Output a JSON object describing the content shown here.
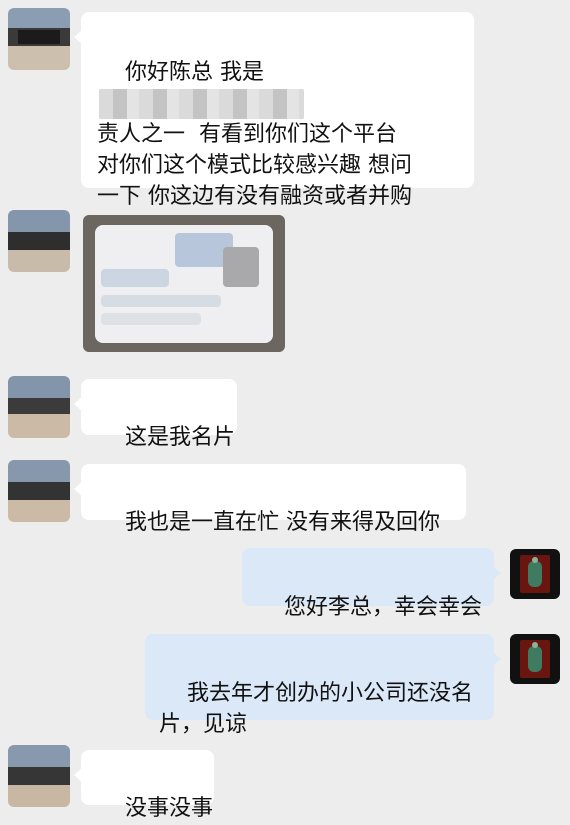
{
  "messages": [
    {
      "side": "in",
      "text_before": "你好陈总 我是",
      "text_after": "\n责人之一  有看到你们这个平台\n对你们这个模式比较感兴趣 想问\n一下 你这边有没有融资或者并购\n的想法 可以聊聊"
    },
    {
      "side": "in",
      "type": "image",
      "content": "blurred business card photo"
    },
    {
      "side": "in",
      "text": "这是我名片"
    },
    {
      "side": "in",
      "text": "我也是一直在忙 没有来得及回你"
    },
    {
      "side": "out",
      "text": "您好李总，幸会幸会"
    },
    {
      "side": "out",
      "text": "我去年才创办的小公司还没名\n片，见谅"
    },
    {
      "side": "in",
      "text": "没事没事"
    }
  ],
  "colors": {
    "background": "#ededed",
    "incoming_bubble": "#ffffff",
    "outgoing_bubble": "#dbe8f8"
  },
  "icons": {
    "contact_avatar": "pixelated-avatar",
    "self_avatar": "dark-figure-avatar"
  }
}
